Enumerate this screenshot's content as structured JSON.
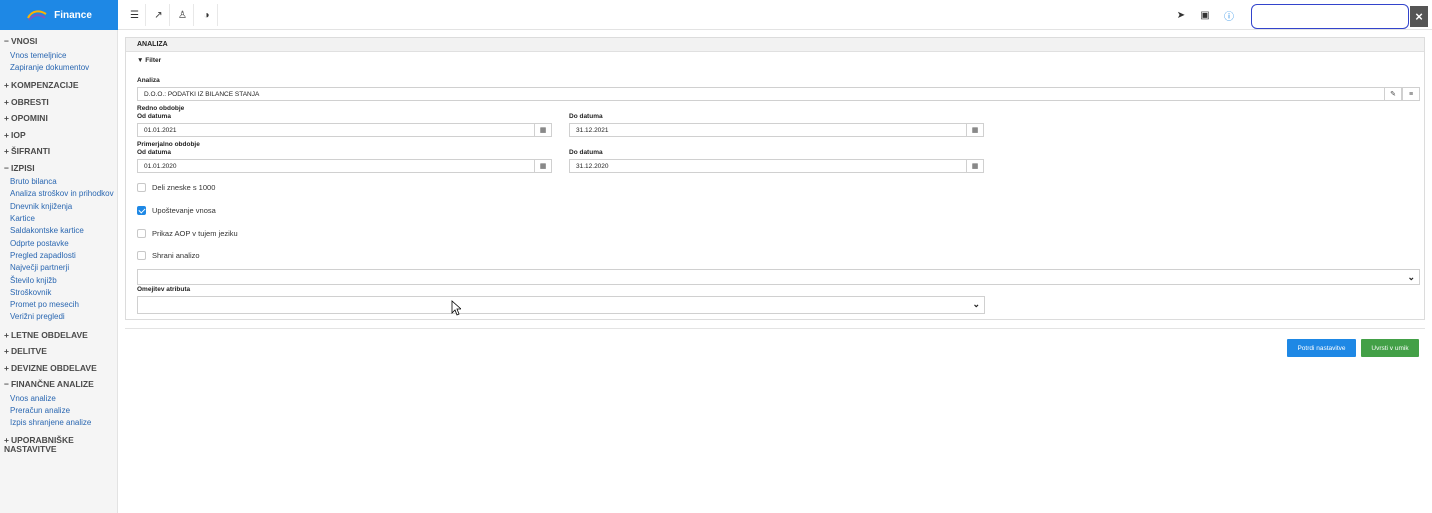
{
  "app": {
    "title": "Finance"
  },
  "toolbar": {
    "left_icons": [
      "menu-icon",
      "external-link-icon",
      "user-icon",
      "contrast-icon"
    ],
    "right_icons": [
      "send-icon",
      "card-icon",
      "info-icon"
    ]
  },
  "search": {
    "placeholder": ""
  },
  "sidebar": {
    "sections": [
      {
        "sign": "−",
        "label": "VNOSI",
        "items": [
          "Vnos temeljnice",
          "Zapiranje dokumentov"
        ]
      },
      {
        "sign": "+",
        "label": "KOMPENZACIJE",
        "items": []
      },
      {
        "sign": "+",
        "label": "OBRESTI",
        "items": []
      },
      {
        "sign": "+",
        "label": "OPOMINI",
        "items": []
      },
      {
        "sign": "+",
        "label": "IOP",
        "items": []
      },
      {
        "sign": "+",
        "label": "ŠIFRANTI",
        "items": []
      },
      {
        "sign": "−",
        "label": "IZPISI",
        "items": [
          "Bruto bilanca",
          "Analiza stroškov in prihodkov",
          "Dnevnik knjiženja",
          "Kartice",
          "Saldakontske kartice",
          "Odprte postavke",
          "Pregled zapadlosti",
          "Največji partnerji",
          "Število knjižb",
          "Stroškovnik",
          "Promet po mesecih",
          "Verižni pregledi"
        ]
      },
      {
        "sign": "+",
        "label": "LETNE OBDELAVE",
        "items": []
      },
      {
        "sign": "+",
        "label": "DELITVE",
        "items": []
      },
      {
        "sign": "+",
        "label": "DEVIZNE OBDELAVE",
        "items": []
      },
      {
        "sign": "−",
        "label": "FINANČNE ANALIZE",
        "items": [
          "Vnos analize",
          "Preračun analize",
          "Izpis shranjene analize"
        ]
      },
      {
        "sign": "+",
        "label": "UPORABNIŠKE NASTAVITVE",
        "items": []
      }
    ]
  },
  "form": {
    "panel_title": "ANALIZA",
    "filter_label": "Filter",
    "analiza_label": "Analiza",
    "analiza_value": "D.O.O.: PODATKI IZ BILANCE STANJA",
    "redno_label": "Redno obdobje",
    "od_label": "Od datuma",
    "do_label": "Do datuma",
    "redno_od": "01.01.2021",
    "redno_do": "31.12.2021",
    "primerjalno_label": "Primerjalno obdobje",
    "prim_od": "01.01.2020",
    "prim_do": "31.12.2020",
    "checkboxes": [
      {
        "label": "Deli zneske s 1000",
        "checked": false
      },
      {
        "label": "Upoštevanje vnosa",
        "checked": true
      },
      {
        "label": "Prikaz AOP v tujem jeziku",
        "checked": false
      },
      {
        "label": "Shrani analizo",
        "checked": false
      }
    ],
    "select_value": "",
    "omejitev_label": "Omejitev atributa",
    "omejitev_value": ""
  },
  "buttons": {
    "confirm": "Potrdi nastavitve",
    "queue": "Uvrsti v umik"
  },
  "colors": {
    "brand": "#1e88e5",
    "green": "#43a047",
    "link": "#2a67b1"
  }
}
